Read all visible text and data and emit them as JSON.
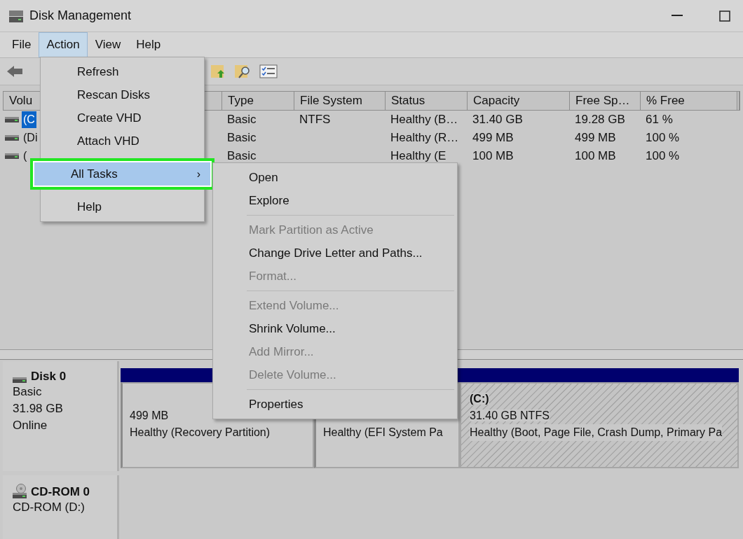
{
  "window": {
    "title": "Disk Management"
  },
  "menu_bar": [
    {
      "label": "File",
      "selected": false
    },
    {
      "label": "Action",
      "selected": true
    },
    {
      "label": "View",
      "selected": false
    },
    {
      "label": "Help",
      "selected": false
    }
  ],
  "volume_table": {
    "columns": [
      "Volu",
      "Type",
      "File System",
      "Status",
      "Capacity",
      "Free Sp…",
      "% Free"
    ],
    "rows": [
      {
        "selected": true,
        "volume": "(C",
        "type": "Basic",
        "file_system": "NTFS",
        "status": "Healthy (B…",
        "capacity": "31.40 GB",
        "free_space": "19.28 GB",
        "percent_free": "61 %"
      },
      {
        "selected": false,
        "volume": "(Di",
        "type": "Basic",
        "status": "Healthy (R…",
        "capacity": "499 MB",
        "free_space": "499 MB",
        "percent_free": "100 %"
      },
      {
        "selected": false,
        "volume": "(",
        "type": "Basic",
        "status": "Healthy (E",
        "capacity": "100 MB",
        "free_space": "100 MB",
        "percent_free": "100 %"
      }
    ]
  },
  "disks": [
    {
      "kind": "disk",
      "name": "Disk 0",
      "lines": [
        "Basic",
        "31.98 GB",
        "Online"
      ],
      "partitions": [
        {
          "selected": false,
          "size": "499 MB",
          "status": "Healthy (Recovery Partition)"
        },
        {
          "selected": false,
          "status": "Healthy (EFI System Pa"
        },
        {
          "selected": true,
          "title": "(C:)",
          "size": "31.40 GB NTFS",
          "status": "Healthy (Boot, Page File, Crash Dump, Primary Pa"
        }
      ]
    },
    {
      "kind": "cdrom",
      "name": "CD-ROM 0",
      "lines": [
        "CD-ROM (D:)"
      ]
    }
  ],
  "action_menu": [
    {
      "label": "Refresh",
      "selected": false
    },
    {
      "label": "Rescan Disks",
      "selected": false
    },
    {
      "label": "Create VHD",
      "selected": false
    },
    {
      "label": "Attach VHD",
      "selected": false
    },
    {
      "label": "All Tasks",
      "selected": true,
      "arrow": "›",
      "highlighted": true
    },
    {
      "label": "Help",
      "selected": false
    }
  ],
  "submenu": [
    {
      "kind": "item",
      "label": "Open",
      "disabled": false
    },
    {
      "kind": "item",
      "label": "Explore",
      "disabled": false
    },
    {
      "kind": "separator"
    },
    {
      "kind": "item",
      "label": "Mark Partition as Active",
      "disabled": true
    },
    {
      "kind": "item",
      "label": "Change Drive Letter and Paths...",
      "disabled": false
    },
    {
      "kind": "item",
      "label": "Format...",
      "disabled": true
    },
    {
      "kind": "separator"
    },
    {
      "kind": "item",
      "label": "Extend Volume...",
      "disabled": true
    },
    {
      "kind": "item",
      "label": "Shrink Volume...",
      "disabled": false
    },
    {
      "kind": "item",
      "label": "Add Mirror...",
      "disabled": true
    },
    {
      "kind": "item",
      "label": "Delete Volume...",
      "disabled": true
    },
    {
      "kind": "separator"
    },
    {
      "kind": "item",
      "label": "Properties",
      "disabled": false
    }
  ]
}
